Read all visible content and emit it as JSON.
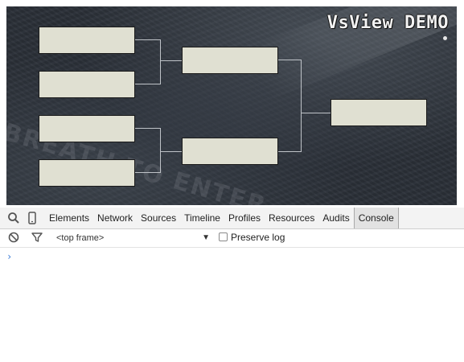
{
  "stage": {
    "title": "VsView DEMO",
    "background_text": "BREATH TO ENTER"
  },
  "bracket": {
    "round1": [
      "",
      "",
      "",
      ""
    ],
    "round2": [
      "",
      ""
    ],
    "final": [
      ""
    ]
  },
  "devtools": {
    "tabs": [
      "Elements",
      "Network",
      "Sources",
      "Timeline",
      "Profiles",
      "Resources",
      "Audits",
      "Console"
    ],
    "active_tab": "Console",
    "frame_select": "<top frame>",
    "preserve_log_label": "Preserve log",
    "prompt_symbol": "›"
  },
  "colors": {
    "slot_fill": "#e0e0d2",
    "bracket_line": "#bfc3c8",
    "prompt": "#3a7bd5"
  }
}
